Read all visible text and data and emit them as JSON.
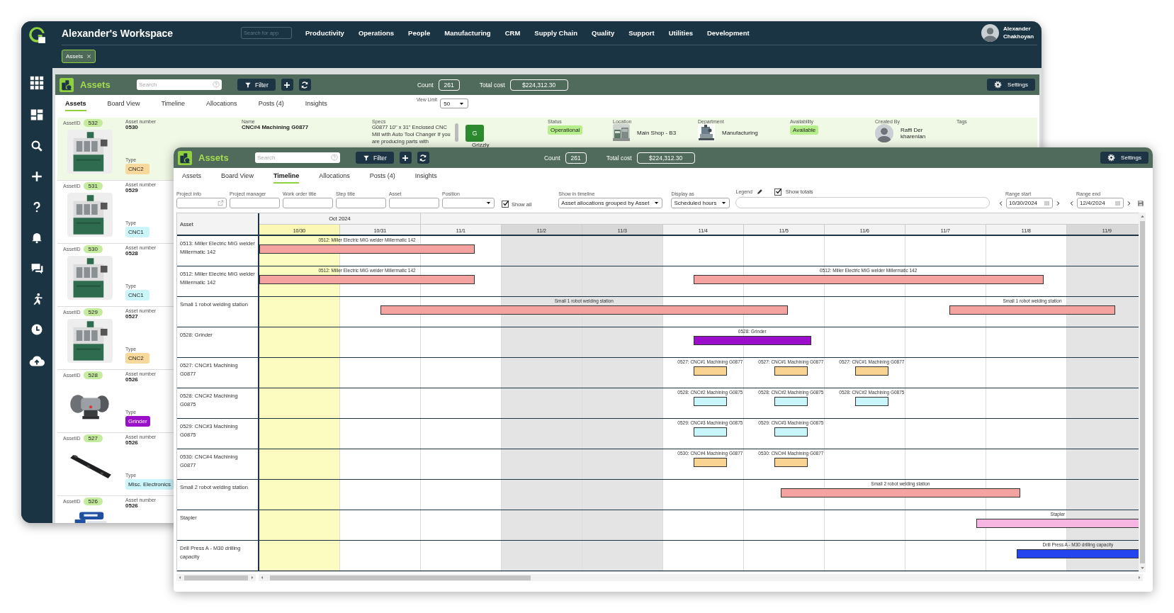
{
  "workspace": {
    "title": "Alexander's Workspace",
    "search": {
      "placeholder": "Search for app"
    },
    "nav": [
      "Productivity",
      "Operations",
      "People",
      "Manufacturing",
      "CRM",
      "Supply Chain",
      "Quality",
      "Support",
      "Utilities",
      "Development"
    ],
    "user": {
      "name": "Alexander Chakhoyan"
    },
    "open_tabs": [
      {
        "label": "Assets",
        "selected": true
      }
    ]
  },
  "back_app": {
    "title": "Assets",
    "search": {
      "placeholder": "Search"
    },
    "filter_button": "Filter",
    "count_label": "Count",
    "count": "261",
    "total_label": "Total cost",
    "total": "$224,312.30",
    "settings_button": "Settings",
    "tabs": [
      {
        "label": "Assets",
        "selected": true
      },
      {
        "label": "Board View",
        "selected": false
      },
      {
        "label": "Timeline",
        "selected": false
      },
      {
        "label": "Allocations",
        "selected": false
      },
      {
        "label": "Posts (4)",
        "selected": false
      },
      {
        "label": "Insights",
        "selected": false
      }
    ],
    "view_limit": {
      "label": "View Limit",
      "value": "50"
    },
    "assets": [
      {
        "id_label": "AssetID",
        "id": "532",
        "number_label": "Asset number",
        "number": "0530",
        "type_label": "Type",
        "type": {
          "label": "CNC2",
          "color": "#f9d89c"
        },
        "selected": true,
        "details": {
          "name_label": "Name",
          "name": "CNC#4 Machining G0877",
          "specs_label": "Specs",
          "specs": "G0877 10\" x 31\" Enclosed CNC Mill with Auto Tool Changer If you are producing parts with",
          "brand": {
            "logo": "G",
            "name": "Grizzly"
          },
          "status_label": "Status",
          "status": "Operational",
          "location_label": "Location",
          "location": "Main Shop - B3",
          "department_label": "Department",
          "department": "Manufacturing",
          "availability_label": "Availability",
          "availability": "Available",
          "created_by_label": "Created By",
          "created_by": "Raffi Der kharenian",
          "tags_label": "Tags"
        }
      },
      {
        "id_label": "AssetID",
        "id": "531",
        "number_label": "Asset number",
        "number": "0529",
        "type_label": "Type",
        "type": {
          "label": "CNC1",
          "color": "#cbf5fb"
        },
        "selected": false
      },
      {
        "id_label": "AssetID",
        "id": "530",
        "number_label": "Asset number",
        "number": "0528",
        "type_label": "Type",
        "type": {
          "label": "CNC1",
          "color": "#cbf5fb"
        },
        "selected": false
      },
      {
        "id_label": "AssetID",
        "id": "529",
        "number_label": "Asset number",
        "number": "0527",
        "type_label": "Type",
        "type": {
          "label": "CNC2",
          "color": "#f9d89c"
        },
        "selected": false
      },
      {
        "id_label": "AssetID",
        "id": "528",
        "number_label": "Asset number",
        "number": "0526",
        "type_label": "Type",
        "type": {
          "label": "Grinder",
          "color": "#9a10c8"
        },
        "selected": false
      },
      {
        "id_label": "AssetID",
        "id": "527",
        "number_label": "Asset number",
        "number": "0526",
        "type_label": "Type",
        "type": {
          "label": "Misc. Electronics",
          "color": "#cbf5fb"
        },
        "selected": false
      },
      {
        "id_label": "AssetID",
        "id": "526",
        "number_label": "Asset number",
        "number": "0526",
        "selected": false
      }
    ]
  },
  "timeline_app": {
    "title": "Assets",
    "search": {
      "placeholder": "Search"
    },
    "filter_button": "Filter",
    "count_label": "Count",
    "count": "261",
    "total_label": "Total cost",
    "total": "$224,312.30",
    "settings_button": "Settings",
    "tabs": [
      {
        "label": "Assets",
        "selected": false
      },
      {
        "label": "Board View",
        "selected": false
      },
      {
        "label": "Timeline",
        "selected": true
      },
      {
        "label": "Allocations",
        "selected": false
      },
      {
        "label": "Posts (4)",
        "selected": false
      },
      {
        "label": "Insights",
        "selected": false
      }
    ],
    "filters": [
      {
        "kind": "link-input",
        "label": "Project info"
      },
      {
        "kind": "input",
        "label": "Project manager"
      },
      {
        "kind": "input",
        "label": "Work order title"
      },
      {
        "kind": "input",
        "label": "Step title"
      },
      {
        "kind": "input",
        "label": "Asset"
      },
      {
        "kind": "select",
        "label": "Position"
      },
      {
        "kind": "checkbox",
        "label": "Show all",
        "checked": true
      },
      {
        "kind": "select",
        "label": "Show in timeline",
        "value": "Asset allocations grouped by Asset"
      },
      {
        "kind": "select",
        "label": "Display as",
        "value": "Scheduled hours"
      },
      {
        "kind": "legend",
        "label": "Legend",
        "show_totals": {
          "label": "Show totals",
          "checked": true
        }
      }
    ],
    "range_start": {
      "label": "Range start",
      "value": "10/30/2024"
    },
    "range_end": {
      "label": "Range end",
      "value": "12/4/2024"
    },
    "timeline": {
      "asset_header": "Asset",
      "months": [
        {
          "label": "Oct 2024",
          "days": [
            {
              "label": "10/30",
              "today": true,
              "weekend": false
            },
            {
              "label": "10/31",
              "today": false,
              "weekend": false
            }
          ]
        },
        {
          "days": [
            {
              "label": "11/1",
              "today": false,
              "weekend": false
            },
            {
              "label": "11/2",
              "today": false,
              "weekend": true
            },
            {
              "label": "11/3",
              "today": false,
              "weekend": true
            },
            {
              "label": "11/4",
              "today": false,
              "weekend": false
            },
            {
              "label": "11/5",
              "today": false,
              "weekend": false
            },
            {
              "label": "11/6",
              "today": false,
              "weekend": false
            },
            {
              "label": "11/7",
              "today": false,
              "weekend": false
            },
            {
              "label": "11/8",
              "today": false,
              "weekend": false
            },
            {
              "label": "11/9",
              "today": false,
              "weekend": true
            }
          ]
        }
      ],
      "rows": [
        {
          "asset": "0513: Miller Electric MIG welder Millermatic 142",
          "bars": [
            {
              "label": "0512: Miller Electric MIG welder Millermatic 142",
              "color": "#f5a3a0"
            }
          ]
        },
        {
          "asset": "0512: Miller Electric MIG welder Millermatic 142",
          "bars": [
            {
              "label": "0512: Miller Electric MIG welder Millermatic 142",
              "color": "#f5a3a0"
            },
            {
              "label": "0512: Miller Electric MIG welder Millermatic 142",
              "color": "#f5a3a0"
            }
          ]
        },
        {
          "asset": "Small 1 robot welding station",
          "bars": [
            {
              "label": "Small 1 robot welding station",
              "color": "#f5a3a0"
            },
            {
              "label": "Small 1 robot welding station",
              "color": "#f5a3a0"
            }
          ]
        },
        {
          "asset": "0528: Grinder",
          "bars": [
            {
              "label": "0528: Grinder",
              "color": "#9b0fcb"
            }
          ]
        },
        {
          "asset": "0527: CNC#1 Machining G0877",
          "bars": [
            {
              "label": "0527: CNC#1 Machining G0877",
              "color": "#f9d392"
            },
            {
              "label": "0527: CNC#1 Machining G0877",
              "color": "#f9d392"
            },
            {
              "label": "0527: CNC#1 Machining G0877",
              "color": "#f9d392"
            }
          ]
        },
        {
          "asset": "0528: CNC#2 Machining G0875",
          "bars": [
            {
              "label": "0528: CNC#2 Machining G0875",
              "color": "#c8f6fb"
            },
            {
              "label": "0528: CNC#2 Machining G0875",
              "color": "#c8f6fb"
            },
            {
              "label": "0528: CNC#2 Machining G0875",
              "color": "#c8f6fb"
            }
          ]
        },
        {
          "asset": "0529: CNC#3 Machining G0875",
          "bars": [
            {
              "label": "0529: CNC#3 Machining G0875",
              "color": "#c8f6fb"
            },
            {
              "label": "0529: CNC#3 Machining G0875",
              "color": "#c8f6fb"
            }
          ]
        },
        {
          "asset": "0530: CNC#4 Machining G0877",
          "bars": [
            {
              "label": "0530: CNC#4 Machining G0877",
              "color": "#f9d392"
            },
            {
              "label": "0530: CNC#4 Machining G0877",
              "color": "#f9d392"
            }
          ]
        },
        {
          "asset": "Small 2 robot welding station",
          "bars": [
            {
              "label": "Small 2 robot welding station",
              "color": "#f5a3a0"
            }
          ]
        },
        {
          "asset": "Stapler",
          "bars": [
            {
              "label": "Stapler",
              "color": "#f7b6e2"
            }
          ]
        },
        {
          "asset": "Drill Press A - M30 drilling capacity",
          "bars": [
            {
              "label": "Drill Press A - M30 drilling capacity",
              "color": "#2444f0"
            }
          ]
        }
      ]
    }
  }
}
